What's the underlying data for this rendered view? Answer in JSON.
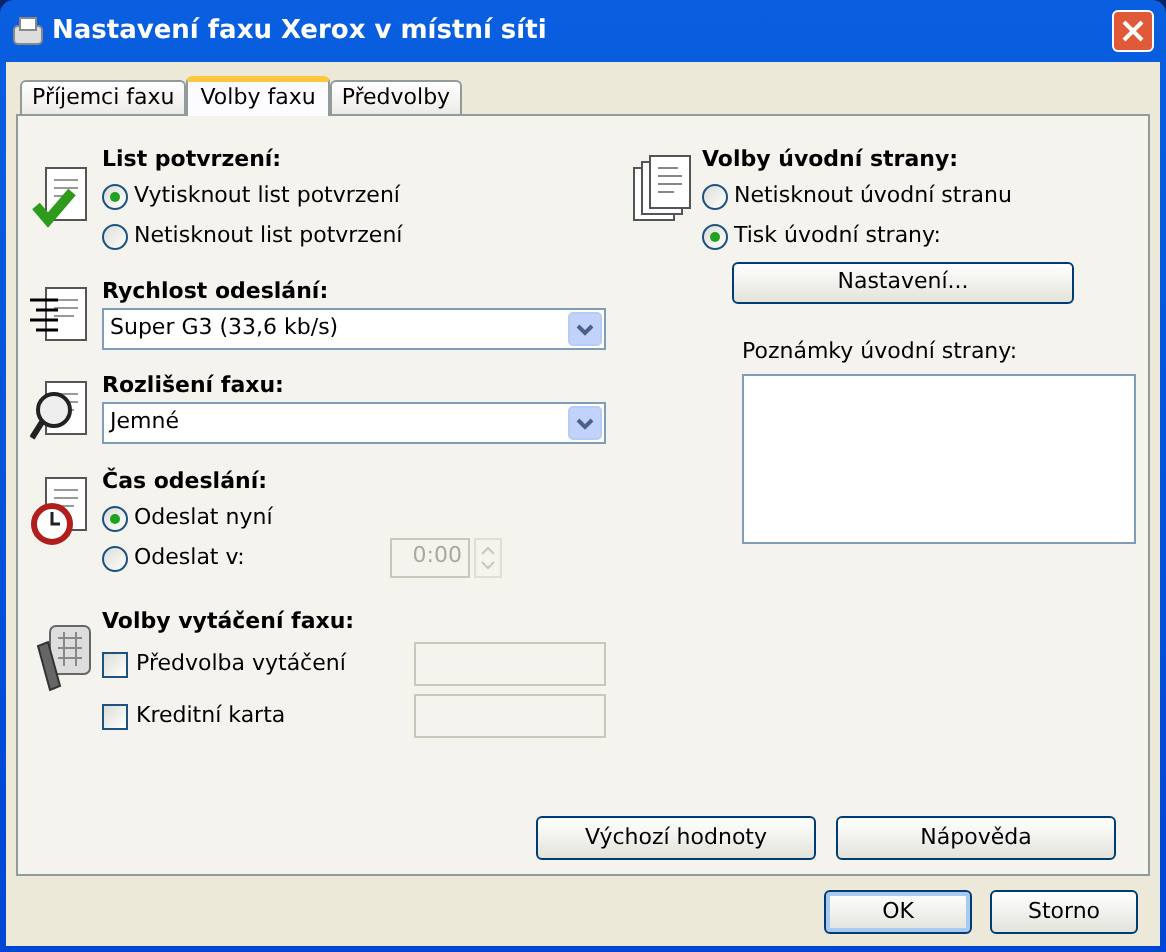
{
  "window": {
    "title": "Nastavení faxu Xerox v místní síti"
  },
  "tabs": [
    {
      "label": "Příjemci faxu",
      "selected": false
    },
    {
      "label": "Volby faxu",
      "selected": true
    },
    {
      "label": "Předvolby",
      "selected": false
    }
  ],
  "confirmation": {
    "heading": "List potvrzení:",
    "options": [
      {
        "label": "Vytisknout list potvrzení",
        "selected": true
      },
      {
        "label": "Netisknout list potvrzení",
        "selected": false
      }
    ]
  },
  "speed": {
    "heading": "Rychlost odeslání:",
    "value": "Super G3 (33,6 kb/s)"
  },
  "resolution": {
    "heading": "Rozlišení faxu:",
    "value": "Jemné"
  },
  "send_time": {
    "heading": "Čas odeslání:",
    "options": [
      {
        "label": "Odeslat nyní",
        "selected": true
      },
      {
        "label": "Odeslat v:",
        "selected": false
      }
    ],
    "time": {
      "value": "0:00",
      "disabled": true
    }
  },
  "dialing": {
    "heading": "Volby vytáčení faxu:",
    "options": [
      {
        "label": "Předvolba vytáčení",
        "checked": false,
        "field_disabled": true
      },
      {
        "label": "Kreditní karta",
        "checked": false,
        "field_disabled": true
      }
    ]
  },
  "cover": {
    "heading": "Volby úvodní strany:",
    "options": [
      {
        "label": "Netisknout úvodní stranu",
        "selected": false
      },
      {
        "label": "Tisk úvodní strany:",
        "selected": true
      }
    ],
    "settings_button": "Nastavení...",
    "notes_label": "Poznámky úvodní strany:"
  },
  "panel_buttons": [
    "Výchozí hodnoty",
    "Nápověda"
  ],
  "buttons": [
    "OK",
    "Storno"
  ]
}
